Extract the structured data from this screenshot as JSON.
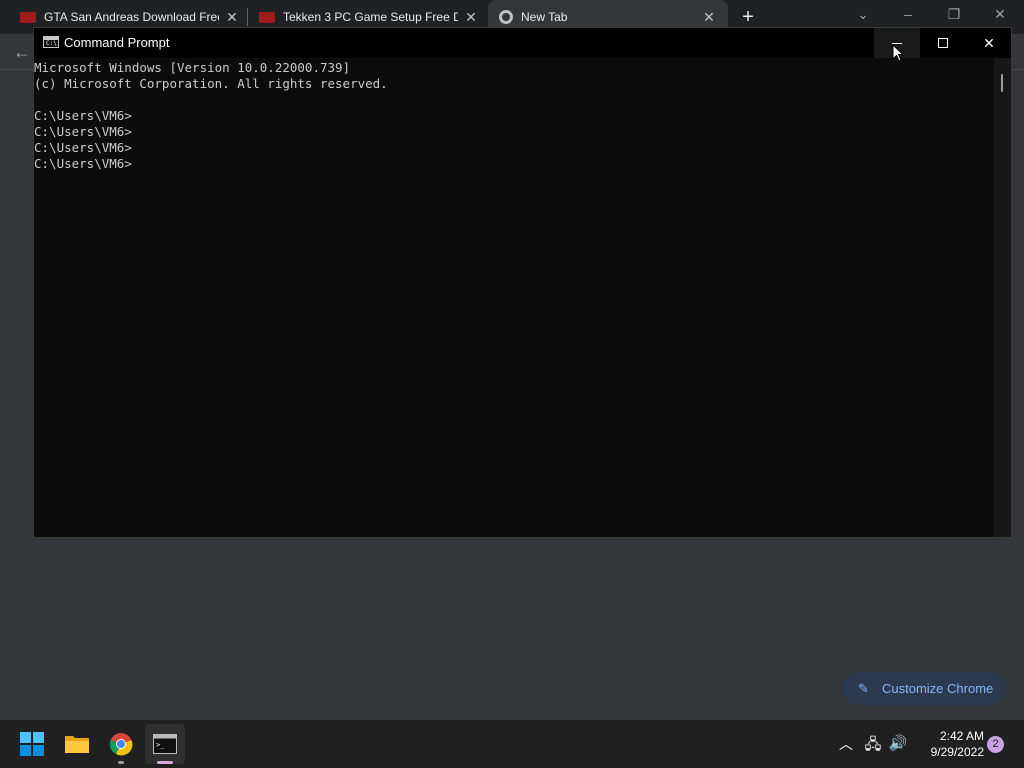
{
  "chrome": {
    "tabs": [
      {
        "title": "GTA San Andreas Download Free",
        "favicon": "red-game-icon",
        "active": false
      },
      {
        "title": "Tekken 3 PC Game Setup Free Do",
        "favicon": "red-game-icon",
        "active": false
      },
      {
        "title": "New Tab",
        "favicon": "chrome-icon",
        "active": true
      }
    ],
    "new_tab_label": "+",
    "customize_label": "Customize Chrome"
  },
  "cmd": {
    "title": "Command Prompt",
    "lines": [
      "Microsoft Windows [Version 10.0.22000.739]",
      "(c) Microsoft Corporation. All rights reserved.",
      "",
      "C:\\Users\\VM6>",
      "C:\\Users\\VM6>",
      "C:\\Users\\VM6>",
      "C:\\Users\\VM6>"
    ],
    "text_color": "#cccccc",
    "background": "#0c0c0c"
  },
  "taskbar": {
    "apps": [
      "start-icon",
      "file-explorer-icon",
      "chrome-icon",
      "command-prompt-icon"
    ],
    "time": "2:42 AM",
    "date": "9/29/2022",
    "notification_count": "2"
  },
  "colors": {
    "accent_blue": "#8ab4f8",
    "windows_blue": "#0078d4"
  }
}
